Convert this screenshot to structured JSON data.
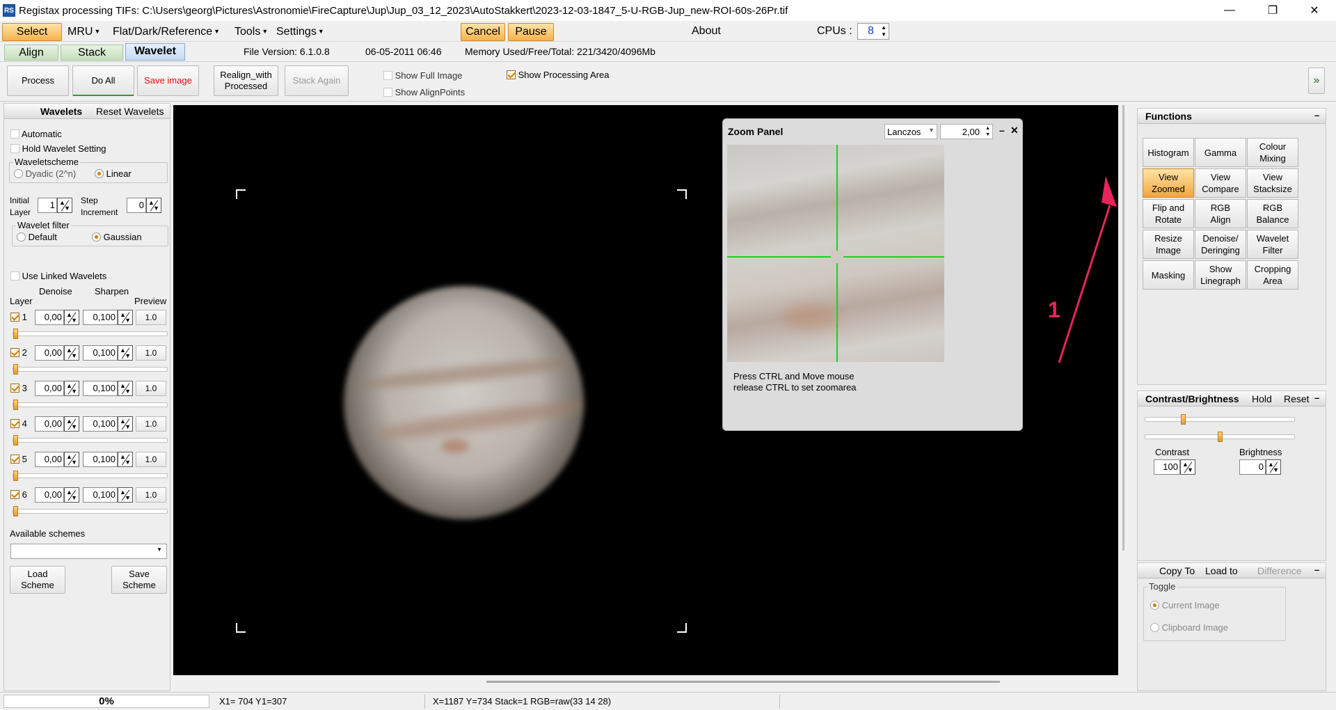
{
  "window": {
    "app_icon": "RS",
    "title": "Registax processing TIFs: C:\\Users\\georg\\Pictures\\Astronomie\\FireCapture\\Jup\\Jup_03_12_2023\\AutoStakkert\\2023-12-03-1847_5-U-RGB-Jup_new-ROI-60s-26Pr.tif",
    "minimize": "—",
    "maximize": "❐",
    "close": "✕"
  },
  "menu": {
    "select": "Select",
    "mru": "MRU",
    "flat": "Flat/Dark/Reference",
    "tools": "Tools",
    "settings": "Settings",
    "cancel": "Cancel",
    "pause": "Pause",
    "about": "About",
    "cpus_label": "CPUs :",
    "cpus_value": "8"
  },
  "tabs": {
    "align": "Align",
    "stack": "Stack",
    "wavelet": "Wavelet"
  },
  "info": {
    "file_version": "File Version: 6.1.0.8",
    "date": "06-05-2011 06:46",
    "memory": "Memory Used/Free/Total: 221/3420/4096Mb"
  },
  "toolbar": {
    "process": "Process",
    "do_all": "Do All",
    "save_image": "Save image",
    "realign_1": "Realign_with",
    "realign_2": "Processed",
    "stack_again": "Stack Again",
    "show_full_image": "Show Full Image",
    "show_alignpoints": "Show AlignPoints",
    "show_processing_area": "Show Processing Area",
    "expand": "»"
  },
  "wavelets": {
    "title": "Wavelets",
    "reset": "Reset Wavelets",
    "automatic": "Automatic",
    "hold": "Hold Wavelet Setting",
    "scheme_title": "Waveletscheme",
    "dyadic": "Dyadic (2^n)",
    "linear": "Linear",
    "initial_1": "Initial",
    "initial_2": "Layer",
    "initial_value": "1",
    "step_1": "Step",
    "step_2": "Increment",
    "step_value": "0",
    "filter_title": "Wavelet filter",
    "default": "Default",
    "gaussian": "Gaussian",
    "use_linked": "Use Linked Wavelets",
    "col_layer": "Layer",
    "col_denoise": "Denoise",
    "col_sharpen": "Sharpen",
    "col_preview": "Preview",
    "layers": [
      {
        "num": "1",
        "denoise": "0,00",
        "sharpen": "0,100",
        "preview": "1.0",
        "level": 0.0
      },
      {
        "num": "2",
        "denoise": "0,00",
        "sharpen": "0,100",
        "preview": "1.0",
        "level": 0.0
      },
      {
        "num": "3",
        "denoise": "0,00",
        "sharpen": "0,100",
        "preview": "1.0",
        "level": 0.0
      },
      {
        "num": "4",
        "denoise": "0,00",
        "sharpen": "0,100",
        "preview": "1.0",
        "level": 0.0
      },
      {
        "num": "5",
        "denoise": "0,00",
        "sharpen": "0,100",
        "preview": "1.0",
        "level": 0.0
      },
      {
        "num": "6",
        "denoise": "0,00",
        "sharpen": "0,100",
        "preview": "1.0",
        "level": 0.0
      }
    ],
    "available_schemes": "Available schemes",
    "load_1": "Load",
    "load_2": "Scheme",
    "save_1": "Save",
    "save_2": "Scheme"
  },
  "zoom_panel": {
    "title": "Zoom Panel",
    "filter": "Lanczos",
    "zoom": "2,00",
    "hint_1": "Press CTRL and Move mouse",
    "hint_2": "release CTRL to set zoomarea"
  },
  "annotation": {
    "number": "1",
    "color": "#e8245a"
  },
  "functions": {
    "title": "Functions",
    "collapse": "–",
    "buttons": [
      {
        "l1": "Histogram",
        "l2": ""
      },
      {
        "l1": "Gamma",
        "l2": ""
      },
      {
        "l1": "Colour",
        "l2": "Mixing"
      },
      {
        "l1": "View",
        "l2": "Zoomed"
      },
      {
        "l1": "View",
        "l2": "Compare"
      },
      {
        "l1": "View",
        "l2": "Stacksize"
      },
      {
        "l1": "Flip and",
        "l2": "Rotate"
      },
      {
        "l1": "RGB",
        "l2": "Align"
      },
      {
        "l1": "RGB",
        "l2": "Balance"
      },
      {
        "l1": "Resize",
        "l2": "Image"
      },
      {
        "l1": "Denoise/",
        "l2": "Deringing"
      },
      {
        "l1": "Wavelet",
        "l2": "Filter"
      },
      {
        "l1": "Masking",
        "l2": ""
      },
      {
        "l1": "Show",
        "l2": "Linegraph"
      },
      {
        "l1": "Cropping",
        "l2": "Area"
      }
    ]
  },
  "contrast": {
    "title": "Contrast/Brightness",
    "hold": "Hold",
    "reset": "Reset",
    "collapse": "–",
    "contrast_label": "Contrast",
    "contrast_value": "100",
    "brightness_label": "Brightness",
    "brightness_value": "0"
  },
  "copy": {
    "copy_to": "Copy To",
    "load_to": "Load to",
    "difference": "Difference",
    "collapse": "–",
    "toggle": "Toggle",
    "current": "Current Image",
    "clipboard": "Clipboard Image"
  },
  "status": {
    "progress": "0%",
    "coords1": "X1= 704 Y1=307",
    "coords2": "X=1187 Y=734 Stack=1 RGB=raw(33 14 28)"
  }
}
